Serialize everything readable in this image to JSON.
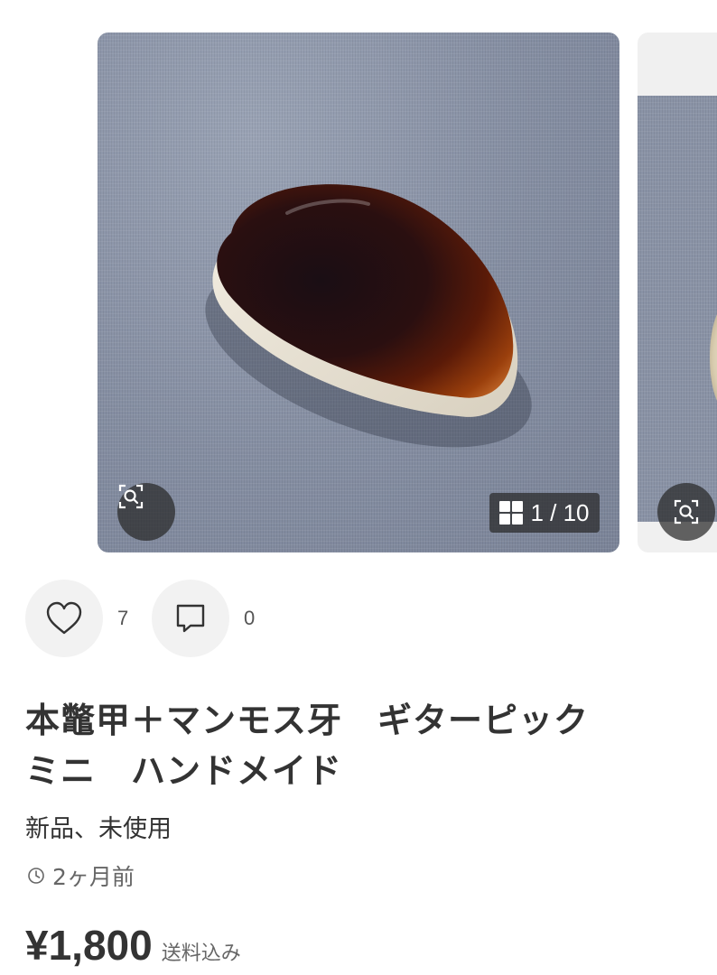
{
  "carousel": {
    "counter": "1 / 10",
    "icons": {
      "zoom": "zoom-search-icon",
      "grid": "grid-icon"
    }
  },
  "actions": {
    "like_count": "7",
    "comment_count": "0",
    "icons": {
      "like": "heart-icon",
      "comment": "comment-icon"
    }
  },
  "item": {
    "title": "本鼈甲＋マンモス牙　ギターピック\nミニ　ハンドメイド",
    "condition": "新品、未使用",
    "posted": "2ヶ月前",
    "price": "¥1,800",
    "shipping": "送料込み"
  },
  "colors": {
    "text": "#333333",
    "muted": "#666666",
    "action_bg": "#f2f2f2",
    "overlay": "#282828"
  }
}
